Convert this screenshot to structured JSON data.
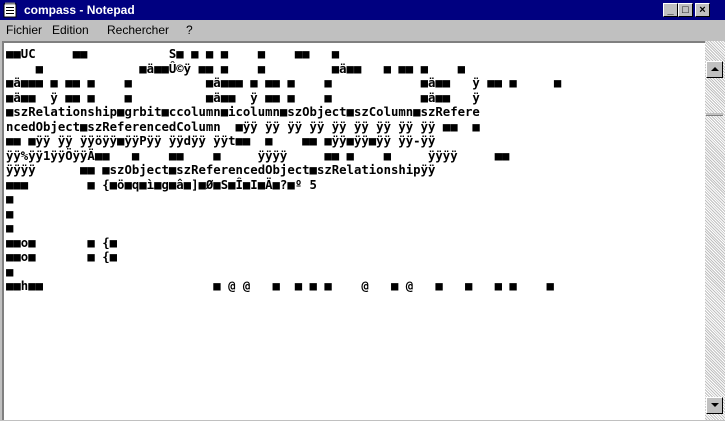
{
  "window": {
    "title": "compass - Notepad"
  },
  "title_buttons": {
    "minimize": "_",
    "maximize": "□",
    "close": "×"
  },
  "menu": [
    {
      "label": "Fichier"
    },
    {
      "label": "Edition"
    },
    {
      "label": "Rechercher"
    },
    {
      "label": "?"
    }
  ],
  "document": {
    "lines": [
      "■■UC     ■■           S■ ■ ■ ■    ■    ■■   ■",
      "    ■             ■ä■■Û©ÿ ■■ ■    ■         ■ä■■   ■ ■■ ■    ■",
      "■ä■■■ ■ ■■ ■    ■          ■ä■■■ ■ ■■ ■    ■            ■ä■■   ÿ ■■ ■     ■",
      "■ä■■  ÿ ■■ ■    ■          ■ä■■  ÿ ■■ ■    ■            ■ä■■   ÿ",
      "■szRelationship■grbit■ccolumn■icolumn■szObject■szColumn■szRefere",
      "ncedObject■szReferencedColumn  ■ÿÿ ÿÿ ÿÿ ÿÿ ÿÿ ÿÿ ÿÿ ÿÿ ÿÿ ■■  ■",
      "■■ ■ÿÿ ÿÿ ÿÿöÿÿ■ÿÿPÿÿ ÿÿdÿÿ ÿÿt■■  ■    ■■ ■ÿÿ■ÿÿ■ÿÿ ÿÿ-ÿÿ",
      "ÿÿ%ÿÿ1ÿÿÖÿÿÄ■■   ■    ■■    ■     ÿÿÿÿ     ■■ ■    ■     ÿÿÿÿ     ■■",
      "ÿÿÿÿ      ■■ ■szObject■szReferencedObject■szRelationshipÿÿ",
      "■■■        ■ {■ö■q■ì■g■â■]■Ø■S■Î■I■Ä■?■º 5",
      "■",
      "■",
      "■",
      "■■o■       ■ {■",
      "■■o■       ■ {■",
      "■",
      "■■h■■                       ■ @ @   ■  ■ ■ ■    @   ■ @   ■   ■   ■ ■    ■"
    ]
  },
  "colors": {
    "titlebar": "#000080",
    "face": "#c0c0c0",
    "editor_bg": "#ffffff"
  }
}
